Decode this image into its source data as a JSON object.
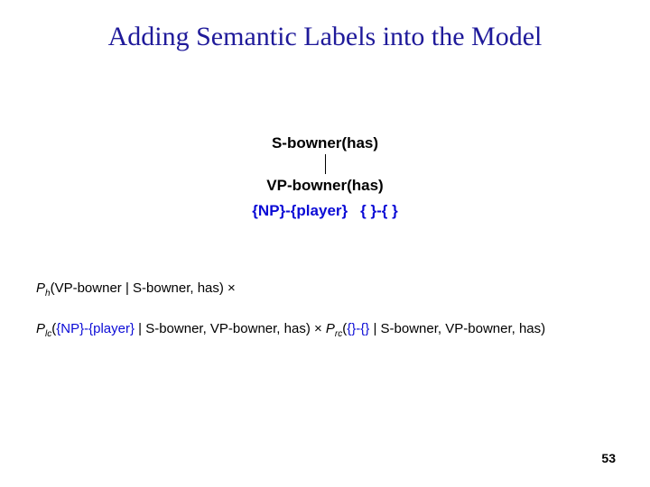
{
  "title": "Adding Semantic Labels into the Model",
  "tree": {
    "root": "S-bowner(has)",
    "mid": "VP-bowner(has)",
    "leaf_left_pre": "{NP}-{player}",
    "leaf_right": "{ }-{ }"
  },
  "formula": {
    "line1_pre": "P",
    "line1_sub": "h",
    "line1_post": "(VP-bowner | S-bowner, has) ×",
    "line2_pre": "P",
    "line2_sub": "lc",
    "line2_openparen": "(",
    "line2_blue": "{NP}-{player}",
    "line2_mid": " | S-bowner, VP-bowner, has) × ",
    "line2_r_pre": "P",
    "line2_r_sub": "rc",
    "line2_r_open": "(",
    "line2_r_blue": "{}-{}",
    "line2_r_post": " | S-bowner, VP-bowner, has)"
  },
  "page": "53"
}
